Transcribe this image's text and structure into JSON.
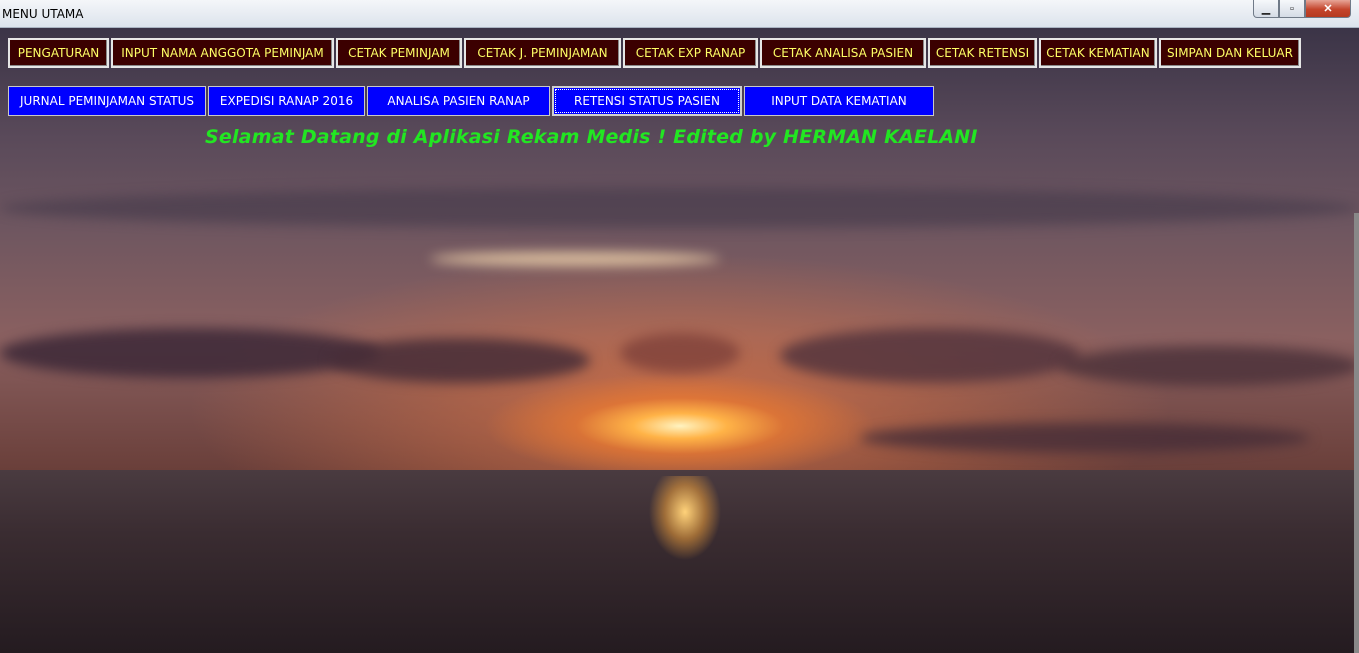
{
  "window": {
    "title": "MENU UTAMA",
    "minimize_label": "▁",
    "maximize_label": "▫",
    "close_label": "✕"
  },
  "menu_row1": [
    {
      "label": "PENGATURAN"
    },
    {
      "label": "INPUT NAMA ANGGOTA PEMINJAM"
    },
    {
      "label": "CETAK PEMINJAM"
    },
    {
      "label": "CETAK J. PEMINJAMAN"
    },
    {
      "label": "CETAK EXP RANAP"
    },
    {
      "label": "CETAK ANALISA PASIEN"
    },
    {
      "label": "CETAK RETENSI"
    },
    {
      "label": "CETAK KEMATIAN"
    },
    {
      "label": "SIMPAN DAN KELUAR"
    }
  ],
  "menu_row2": [
    {
      "label": "JURNAL PEMINJAMAN STATUS"
    },
    {
      "label": "EXPEDISI RANAP 2016"
    },
    {
      "label": "ANALISA PASIEN RANAP"
    },
    {
      "label": "RETENSI STATUS PASIEN"
    },
    {
      "label": "INPUT DATA KEMATIAN"
    }
  ],
  "welcome_text": "Selamat Datang di Aplikasi Rekam Medis !  Edited by HERMAN KAELANI",
  "colors": {
    "row1_bg": "#3b0000",
    "row1_text": "#ffff66",
    "row2_bg": "#0000ff",
    "row2_text": "#ffffff",
    "welcome": "#22e622"
  }
}
